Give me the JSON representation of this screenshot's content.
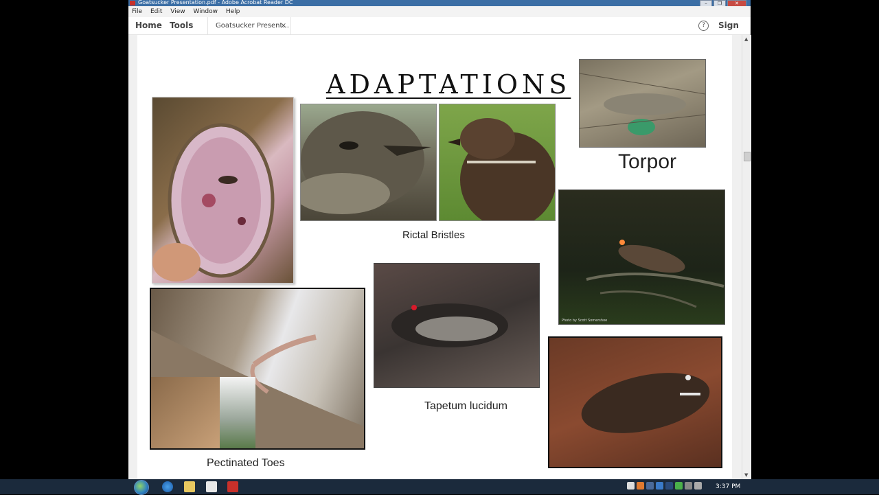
{
  "window": {
    "title": "Goatsucker Presentation.pdf - Adobe Acrobat Reader DC",
    "controls": [
      "–",
      "❐",
      "✕"
    ]
  },
  "menu": [
    "File",
    "Edit",
    "View",
    "Window",
    "Help"
  ],
  "toolbar": {
    "home": "Home",
    "tools": "Tools",
    "doc_tab": "Goatsucker Present...",
    "doc_tab_close": "×",
    "help": "?",
    "sign_in": "Sign In"
  },
  "slide": {
    "title": "ADAPTATIONS",
    "captions": {
      "torpor": "Torpor",
      "rictal": "Rictal Bristles",
      "tapetum": "Tapetum lucidum",
      "toes": "Pectinated Toes"
    },
    "photo_credit": "Photo by Scott Somershoe"
  },
  "taskbar": {
    "time": "3:37 PM"
  },
  "colors": {
    "titlebar": "#3b6ea5",
    "taskbar": "#1b2a3c"
  }
}
